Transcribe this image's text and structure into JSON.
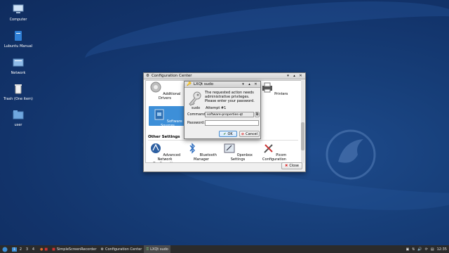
{
  "desktop": {
    "icons": [
      {
        "label": "Computer",
        "icon": "computer-icon"
      },
      {
        "label": "Lubuntu Manual",
        "icon": "manual-icon"
      },
      {
        "label": "Network",
        "icon": "network-icon"
      },
      {
        "label": "Trash (One item)",
        "icon": "trash-icon"
      },
      {
        "label": "user",
        "icon": "home-folder-icon"
      }
    ]
  },
  "config_center": {
    "title": "Configuration Center",
    "items": [
      {
        "label": "Additional Drivers",
        "icon": "drivers-icon"
      },
      {
        "label": "Software Sources",
        "icon": "software-sources-icon"
      },
      {
        "label": "Printers",
        "icon": "printer-icon"
      },
      {
        "label": "Advanced Network Configuration",
        "icon": "network-config-icon"
      },
      {
        "label": "Bluetooth Manager",
        "icon": "bluetooth-icon"
      },
      {
        "label": "Openbox Settings",
        "icon": "openbox-icon"
      },
      {
        "label": "Picom Configuration",
        "icon": "picom-icon"
      }
    ],
    "other_settings_label": "Other Settings",
    "close_label": "Close"
  },
  "sudo_dialog": {
    "title": "LXQt sudo",
    "message": "The requested action needs administrative privileges. Please enter your password.",
    "tool": "sudo",
    "attempt": "Attempt #1",
    "command_label": "Command:",
    "command_value": "software-properties-qt",
    "password_label": "Password:",
    "password_value": "",
    "ok_label": "OK",
    "cancel_label": "Cancel"
  },
  "taskbar": {
    "desktops": [
      "1",
      "2",
      "3",
      "4"
    ],
    "tasks": [
      {
        "label": "SimpleScreenRecorder",
        "icon": "recorder-icon",
        "active": false
      },
      {
        "label": "Configuration Center",
        "icon": "config-icon",
        "active": false
      },
      {
        "label": "LXQt sudo",
        "icon": "sudo-icon",
        "active": true
      }
    ],
    "clock": "12:35"
  },
  "colors": {
    "desktop_bg": "#173f7a",
    "selection": "#3d8fd8",
    "taskbar_bg": "#2b2b2b"
  }
}
